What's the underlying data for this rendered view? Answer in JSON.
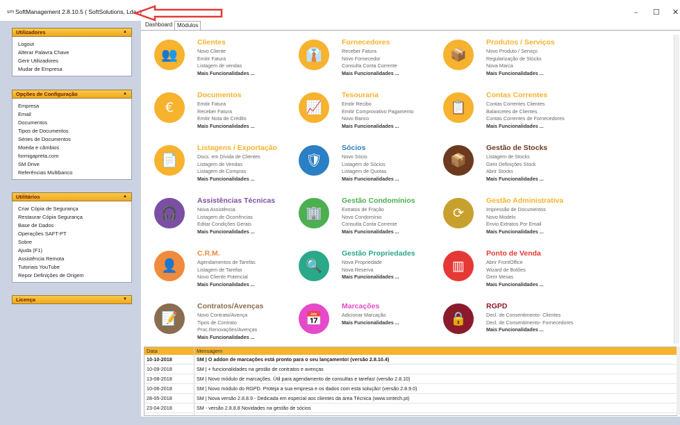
{
  "window": {
    "icon": "sm",
    "title": "SoftManagement 2.8.10.5 ( SoftSolutions, Lda. )",
    "minimize": "–",
    "maximize": "☐",
    "close": "✕"
  },
  "sidebar": {
    "panels": [
      {
        "title": "Utilizadores",
        "expanded": true,
        "items": [
          "Logout",
          "Alterar Palavra Chave",
          "Gerir Utilizadores",
          "Mudar de Empresa"
        ]
      },
      {
        "title": "Opções de Configuração",
        "expanded": true,
        "items": [
          "Empresa",
          "Email",
          "Documentos",
          "Tipos de Documentos",
          "Séries de Documentos",
          "Moeda e câmbios",
          "formigapreta.com",
          "SM Drive",
          "Referências Multibanco"
        ]
      },
      {
        "title": "Utilitários",
        "expanded": true,
        "items": [
          "Criar Cópia de Segurança",
          "Restaurar Cópia Segurança",
          "Base de Dados",
          "Operações SAFT-PT",
          "Sobre",
          "Ajuda (F1)",
          "Assistência Remota",
          "Tutoriais YouTube",
          "Repor Definições de Origem"
        ]
      },
      {
        "title": "Licença",
        "expanded": false,
        "items": []
      }
    ]
  },
  "tabs": [
    {
      "label": "Dashboard",
      "active": false
    },
    {
      "label": "Módulos",
      "active": true
    }
  ],
  "modules": [
    {
      "title": "Clientes",
      "color": "#f7b22e",
      "circle": "#f7b22e",
      "icon": "people-icon",
      "glyph": "👥",
      "links": [
        "Novo Cliente",
        "Emitir Fatura",
        "Listagem de vendas"
      ],
      "more": "Mais Funcionalidades ..."
    },
    {
      "title": "Fornecedores",
      "color": "#f7b22e",
      "circle": "#f7b22e",
      "icon": "suppliers-icon",
      "glyph": "👔",
      "links": [
        "Receber Fatura",
        "Novo Fornecedor",
        "Consulta Conta Corrente"
      ],
      "more": "Mais Funcionalidades ..."
    },
    {
      "title": "Produtos / Serviços",
      "color": "#f7b22e",
      "circle": "#f7b22e",
      "icon": "boxes-icon",
      "glyph": "📦",
      "links": [
        "Novo Produto / Serviço",
        "Regularização de Stocks",
        "Nova Marca"
      ],
      "more": "Mais Funcionalidades ..."
    },
    {
      "title": "Documentos",
      "color": "#f7b22e",
      "circle": "#f7b22e",
      "icon": "euro-document-icon",
      "glyph": "€",
      "links": [
        "Emitir Fatura",
        "Receber Fatura",
        "Emitir Nota de Crédito"
      ],
      "more": "Mais Funcionalidades ..."
    },
    {
      "title": "Tesouraria",
      "color": "#f7b22e",
      "circle": "#f7b22e",
      "icon": "growth-chart-icon",
      "glyph": "📈",
      "links": [
        "Emitir Recibo",
        "Emitir Comprovativo Pagamento",
        "Novo Banco"
      ],
      "more": "Mais Funcionalidades ..."
    },
    {
      "title": "Contas Correntes",
      "color": "#f7b22e",
      "circle": "#f7b22e",
      "icon": "ledger-icon",
      "glyph": "📋",
      "links": [
        "Contas Correntes Clientes",
        "Balancetes de Clientes",
        "Contas Correntes de Fornecedores"
      ],
      "more": "Mais Funcionalidades ..."
    },
    {
      "title": "Listagens / Exportação",
      "color": "#f7b22e",
      "circle": "#f7b22e",
      "icon": "list-export-icon",
      "glyph": "📄",
      "links": [
        "Docs. em Dívida de Clientes",
        "Listagem de Vendas",
        "Listagem de Compras"
      ],
      "more": "Mais Funcionalidades ..."
    },
    {
      "title": "Sócios",
      "color": "#2b7fc4",
      "circle": "#2b7fc4",
      "icon": "members-shield-icon",
      "glyph": "🛡",
      "links": [
        "Novo Sócio",
        "Listagem de Sócios",
        "Listagem de Quotas"
      ],
      "more": "Mais Funcionalidades ..."
    },
    {
      "title": "Gestão de Stocks",
      "color": "#6b3a1f",
      "circle": "#6b3a1f",
      "icon": "stock-boxes-icon",
      "glyph": "📦",
      "links": [
        "Listagem de Stocks",
        "Gerir Definições Stock",
        "Abrir Stocks"
      ],
      "more": "Mais Funcionalidades ..."
    },
    {
      "title": "Assistências Técnicas",
      "color": "#7b4fa3",
      "circle": "#7b4fa3",
      "icon": "support-agent-icon",
      "glyph": "🎧",
      "links": [
        "Nova Assistência",
        "Listagem de Ocorrências",
        "Editar Condições Gerais"
      ],
      "more": "Mais Funcionalidades ..."
    },
    {
      "title": "Gestão Condomínios",
      "color": "#4caf50",
      "circle": "#4caf50",
      "icon": "building-icon",
      "glyph": "🏢",
      "links": [
        "Extratos de Fração",
        "Novo Condomínio",
        "Consulta Conta Corrente"
      ],
      "more": "Mais Funcionalidades ..."
    },
    {
      "title": "Gestão Administrativa",
      "color": "#f7b22e",
      "circle": "#c8a02e",
      "icon": "admin-cycle-icon",
      "glyph": "⟳",
      "links": [
        "Impressão de Documentos",
        "Novo Modelo",
        "Envio Extratos Por Email"
      ],
      "more": "Mais Funcionalidades ..."
    },
    {
      "title": "C.R.M.",
      "color": "#f08a3c",
      "circle": "#f08a3c",
      "icon": "crm-people-icon",
      "glyph": "👤",
      "links": [
        "Agendamentos de Tarefas",
        "Listagem de Tarefas",
        "Novo Cliente Potencial"
      ],
      "more": "Mais Funcionalidades ..."
    },
    {
      "title": "Gestão Propriedades",
      "color": "#2aa88a",
      "circle": "#2aa88a",
      "icon": "property-search-icon",
      "glyph": "🔍",
      "links": [
        "Nova Propriedade",
        "Nova Reserva"
      ],
      "more": "Mais Funcionalidades ..."
    },
    {
      "title": "Ponto de Venda",
      "color": "#e53935",
      "circle": "#e53935",
      "icon": "barcode-icon",
      "glyph": "▥",
      "links": [
        "Abrir FrontOffice",
        "Wizard de Botões",
        "Gerir Mesas"
      ],
      "more": "Mais Funcionalidades ..."
    },
    {
      "title": "Contratos/Avenças",
      "color": "#8a6d4f",
      "circle": "#8a6d4f",
      "icon": "contract-icon",
      "glyph": "📝",
      "links": [
        "Novo Contrato/Avença",
        "Tipos de Contrato",
        "Proc.Renovações/Avenças"
      ],
      "more": "Mais Funcionalidades ..."
    },
    {
      "title": "Marcações",
      "color": "#e649c9",
      "circle": "#e649c9",
      "icon": "calendar-icon",
      "glyph": "📅",
      "links": [
        "Adicionar Marcação"
      ],
      "more": "Mais Funcionalidades ..."
    },
    {
      "title": "RGPD",
      "color": "#8b1a2b",
      "circle": "#8b1a2b",
      "icon": "lock-icon",
      "glyph": "🔒",
      "links": [
        "Decl. de Consentimento- Clientes",
        "Decl. de Consentimento- Fornecedores"
      ],
      "more": "Mais Funcionalidades ..."
    }
  ],
  "news": {
    "headers": [
      "Data",
      "Mensagem"
    ],
    "rows": [
      {
        "date": "10-10-2018",
        "message": "SM | O addon de marcações está pronto para o seu lançamento! (versão 2.8.10.4)",
        "bold": true
      },
      {
        "date": "10-09-2018",
        "message": "SM | + funcionalidades na gestão de contratos e avenças",
        "bold": false
      },
      {
        "date": "13-08-2018",
        "message": "SM | Novo módulo de marcações. Útil para agendamento de consultas e tarefas! (versão 2.8.10)",
        "bold": false
      },
      {
        "date": "10-06-2018",
        "message": "SM | Novo módulo do RGPD. Proteja a sua empresa e os dados com esta solução! (versão 2.8.9.0)",
        "bold": false
      },
      {
        "date": "28-05-2018",
        "message": "SM | Nova versão 2.8.8.9 - Dedicada em especial aos clientes da área Técnica (www.smtech.pt)",
        "bold": false
      },
      {
        "date": "23-04-2018",
        "message": "SM - versão 2.8.8.8 Novidades na gestão de sócios",
        "bold": false
      }
    ]
  }
}
